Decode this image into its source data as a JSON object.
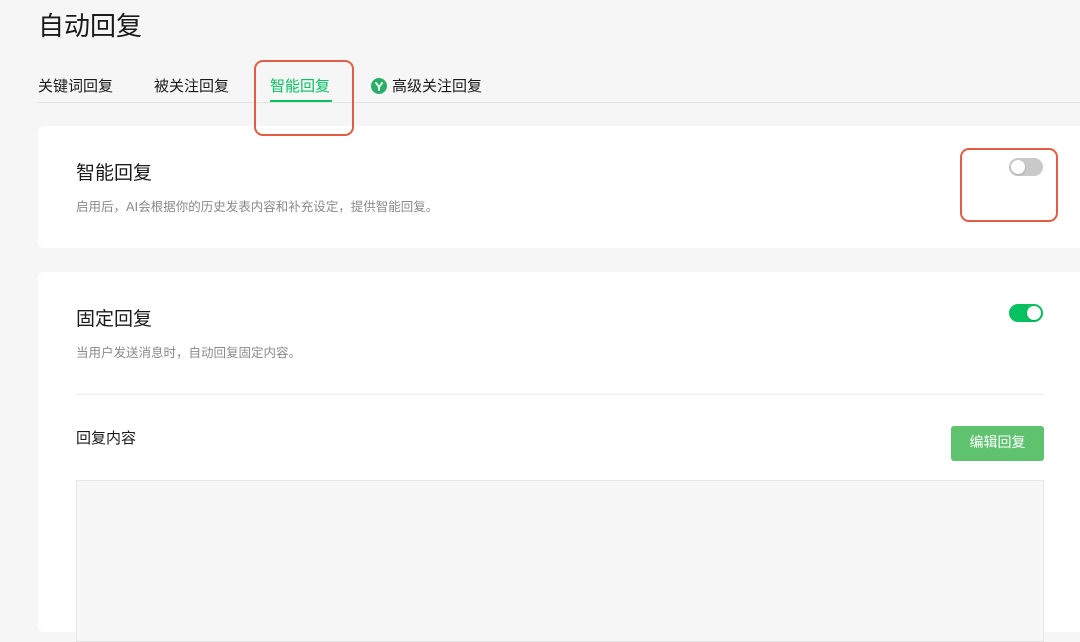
{
  "page": {
    "title": "自动回复"
  },
  "tabs": [
    {
      "label": "关键词回复",
      "active": false
    },
    {
      "label": "被关注回复",
      "active": false
    },
    {
      "label": "智能回复",
      "active": true
    },
    {
      "label": "高级关注回复",
      "active": false,
      "badge": "y"
    }
  ],
  "smart_reply": {
    "title": "智能回复",
    "description": "启用后，AI会根据你的历史发表内容和补充设定，提供智能回复。",
    "enabled": false
  },
  "fixed_reply": {
    "title": "固定回复",
    "description": "当用户发送消息时，自动回复固定内容。",
    "enabled": true,
    "content_label": "回复内容",
    "edit_button": "编辑回复"
  },
  "colors": {
    "accent": "#07c160",
    "button": "#5fc26f",
    "highlight": "#e25d43"
  }
}
